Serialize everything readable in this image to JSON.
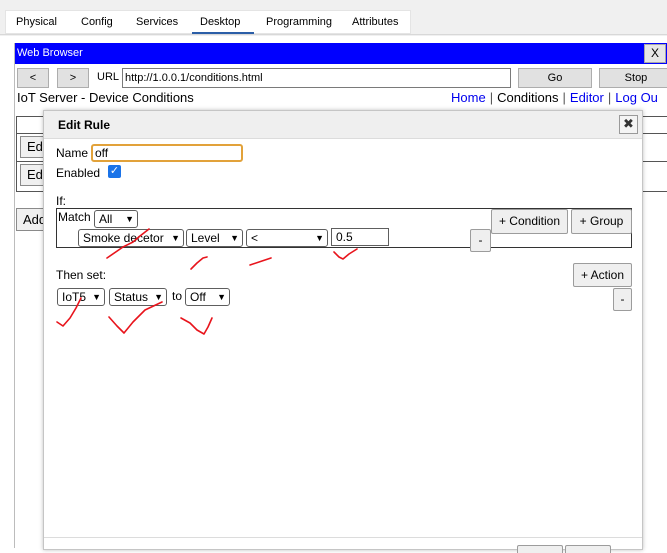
{
  "tabs": [
    "Physical",
    "Config",
    "Services",
    "Desktop",
    "Programming",
    "Attributes"
  ],
  "active_tab": "Desktop",
  "window": {
    "title": "Web Browser",
    "close": "X"
  },
  "nav": {
    "back": "<",
    "forward": ">",
    "url_label": "URL",
    "url": "http://1.0.0.1/conditions.html",
    "go": "Go",
    "stop": "Stop"
  },
  "page": {
    "title": "IoT Server - Device Conditions",
    "links": [
      "Home",
      "Conditions",
      "Editor",
      "Log Ou"
    ],
    "edit_button": "Ed",
    "add_button": "Add"
  },
  "dialog": {
    "title": "Edit Rule",
    "close": "✖",
    "name_label": "Name",
    "name_value": "off",
    "enabled_label": "Enabled",
    "enabled_checked": true,
    "if_label": "If:",
    "match_label": "Match",
    "match_value": "All",
    "condition": {
      "device": "Smoke decetor",
      "property": "Level",
      "operator": "<",
      "value": "0.5"
    },
    "add_condition": "+ Condition",
    "add_group": "+ Group",
    "remove": "-",
    "then_label": "Then set:",
    "action": {
      "device": "IoT5",
      "property": "Status",
      "to_label": "to",
      "value": "Off"
    },
    "add_action": "+ Action"
  },
  "annotation_color": "#e8141c"
}
